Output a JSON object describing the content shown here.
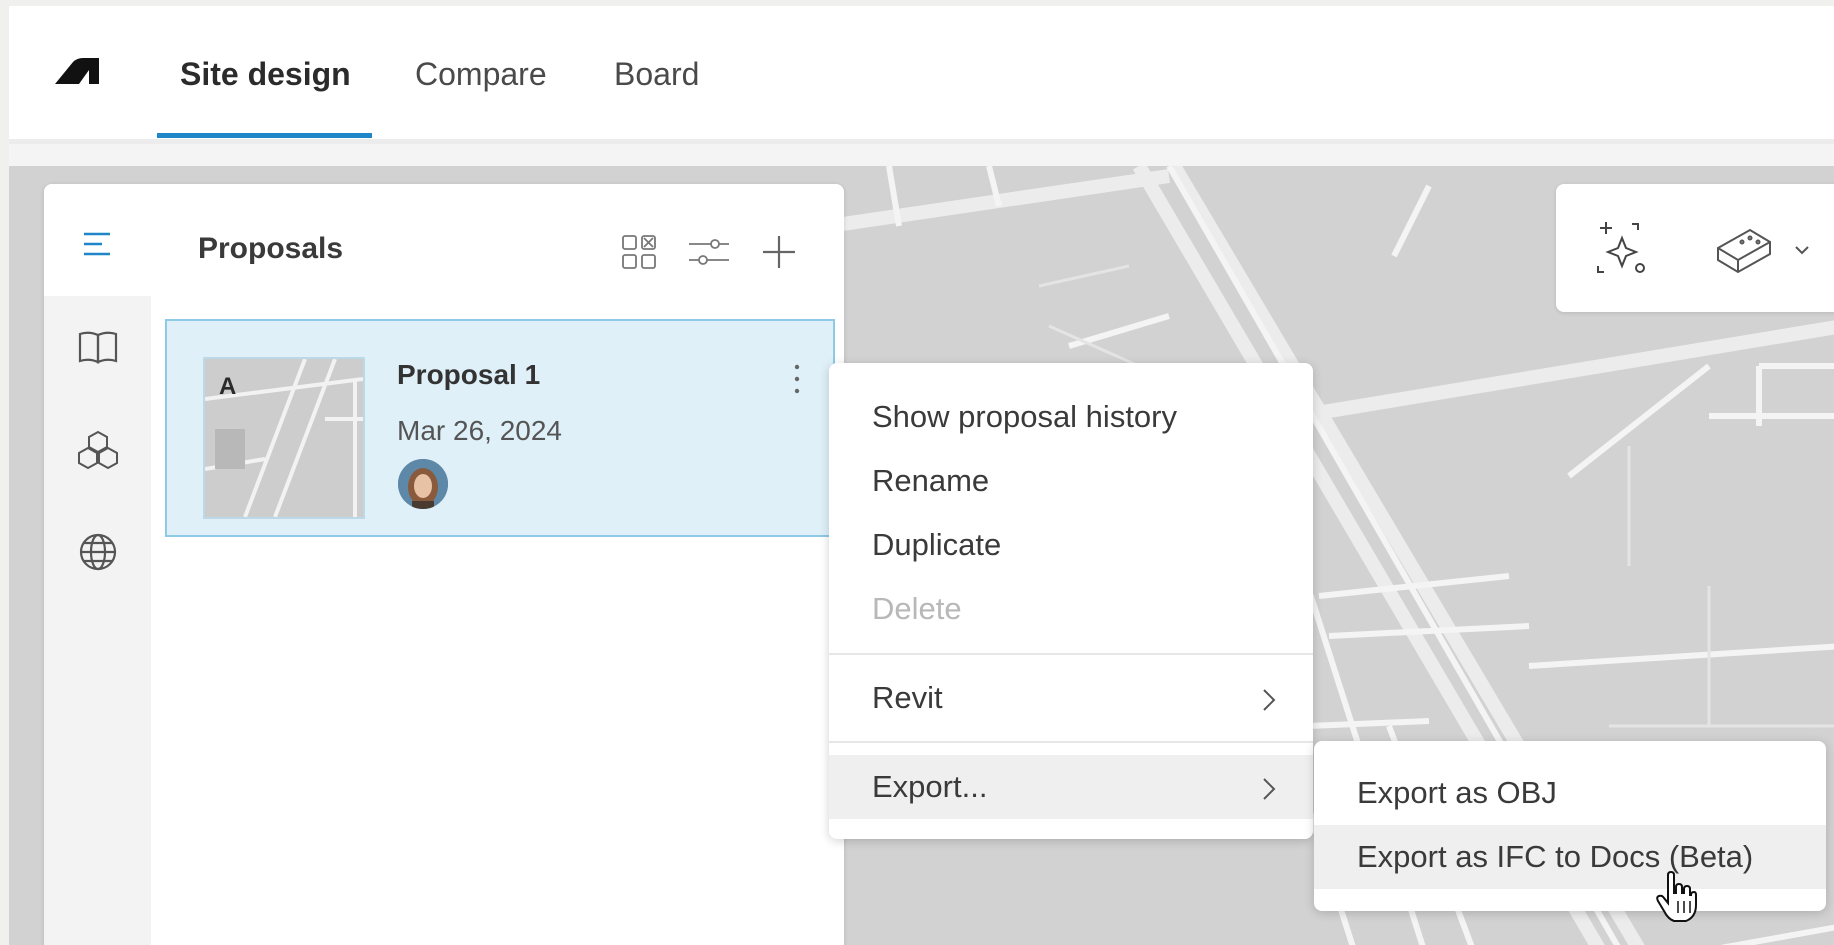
{
  "app": {
    "tabs": [
      {
        "label": "Site design",
        "active": true
      },
      {
        "label": "Compare",
        "active": false
      },
      {
        "label": "Board",
        "active": false
      }
    ]
  },
  "panel": {
    "title": "Proposals",
    "rail_icons": [
      "list-icon",
      "book-icon",
      "cubes-icon",
      "globe-icon"
    ],
    "tool_icons": [
      "grid-view-icon",
      "filter-sliders-icon",
      "add-icon"
    ]
  },
  "proposal": {
    "letter": "A",
    "name": "Proposal 1",
    "date": "Mar 26, 2024"
  },
  "context_menu": {
    "items": [
      {
        "label": "Show proposal history",
        "disabled": false
      },
      {
        "label": "Rename",
        "disabled": false
      },
      {
        "label": "Duplicate",
        "disabled": false
      },
      {
        "label": "Delete",
        "disabled": true
      },
      {
        "label": "Revit",
        "has_submenu": true
      },
      {
        "label": "Export...",
        "has_submenu": true,
        "highlighted": true
      }
    ]
  },
  "export_submenu": {
    "items": [
      {
        "label": "Export as OBJ"
      },
      {
        "label": "Export as IFC to Docs (Beta)",
        "highlighted": true
      }
    ]
  },
  "right_toolbar": {
    "icons": [
      "ai-sparkle-icon",
      "building-block-icon",
      "chevron-down-icon"
    ]
  },
  "colors": {
    "accent": "#1f86c8",
    "selected_card_bg": "#dff0f8",
    "selected_card_border": "#8ec9e6",
    "map_bg": "#d4d4d4"
  }
}
